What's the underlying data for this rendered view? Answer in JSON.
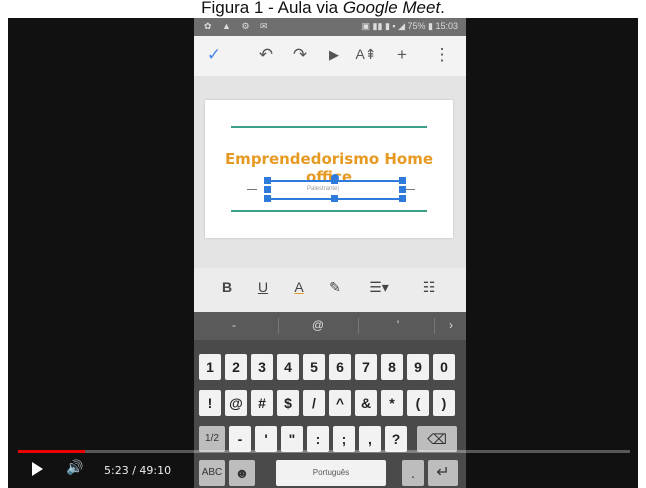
{
  "caption": {
    "prefix": "Figura 1 - Aula via ",
    "italic": "Google Meet",
    "suffix": "."
  },
  "phone": {
    "status": {
      "left": "✿ ▲ ⚙ ✉",
      "right": "▣ ▮▮ ▮ ▪ ◢ 75% ▮ 15:03"
    },
    "toolbar": {
      "check": "✓",
      "undo": "↶",
      "redo": "↷",
      "play": "▶",
      "text_format": "A⇞",
      "add": "+",
      "more": "⋮"
    },
    "slide": {
      "title": "Emprendedorismo Home office",
      "placeholder": "Palestrante|"
    },
    "format": {
      "bold": "B",
      "underline": "U",
      "text_color": "A",
      "highlight": "✎",
      "align": "☰▾",
      "list": "☷"
    },
    "keyboard": {
      "suggestions": [
        "-",
        "@",
        "'",
        "›"
      ],
      "row1": [
        "1",
        "2",
        "3",
        "4",
        "5",
        "6",
        "7",
        "8",
        "9",
        "0"
      ],
      "row2": [
        "!",
        "@",
        "#",
        "$",
        "/",
        "^",
        "&",
        "*",
        "(",
        ")"
      ],
      "row3": [
        "1/2",
        "-",
        "'",
        "\"",
        ":",
        ";",
        ",",
        "?",
        "⌫"
      ],
      "row4": {
        "abc": "ABC",
        "emoji": "☻",
        "space": "Português",
        "dot": ".",
        "enter": "↵"
      }
    }
  },
  "player": {
    "time": "5:23 / 49:10",
    "progress": 0.11
  }
}
